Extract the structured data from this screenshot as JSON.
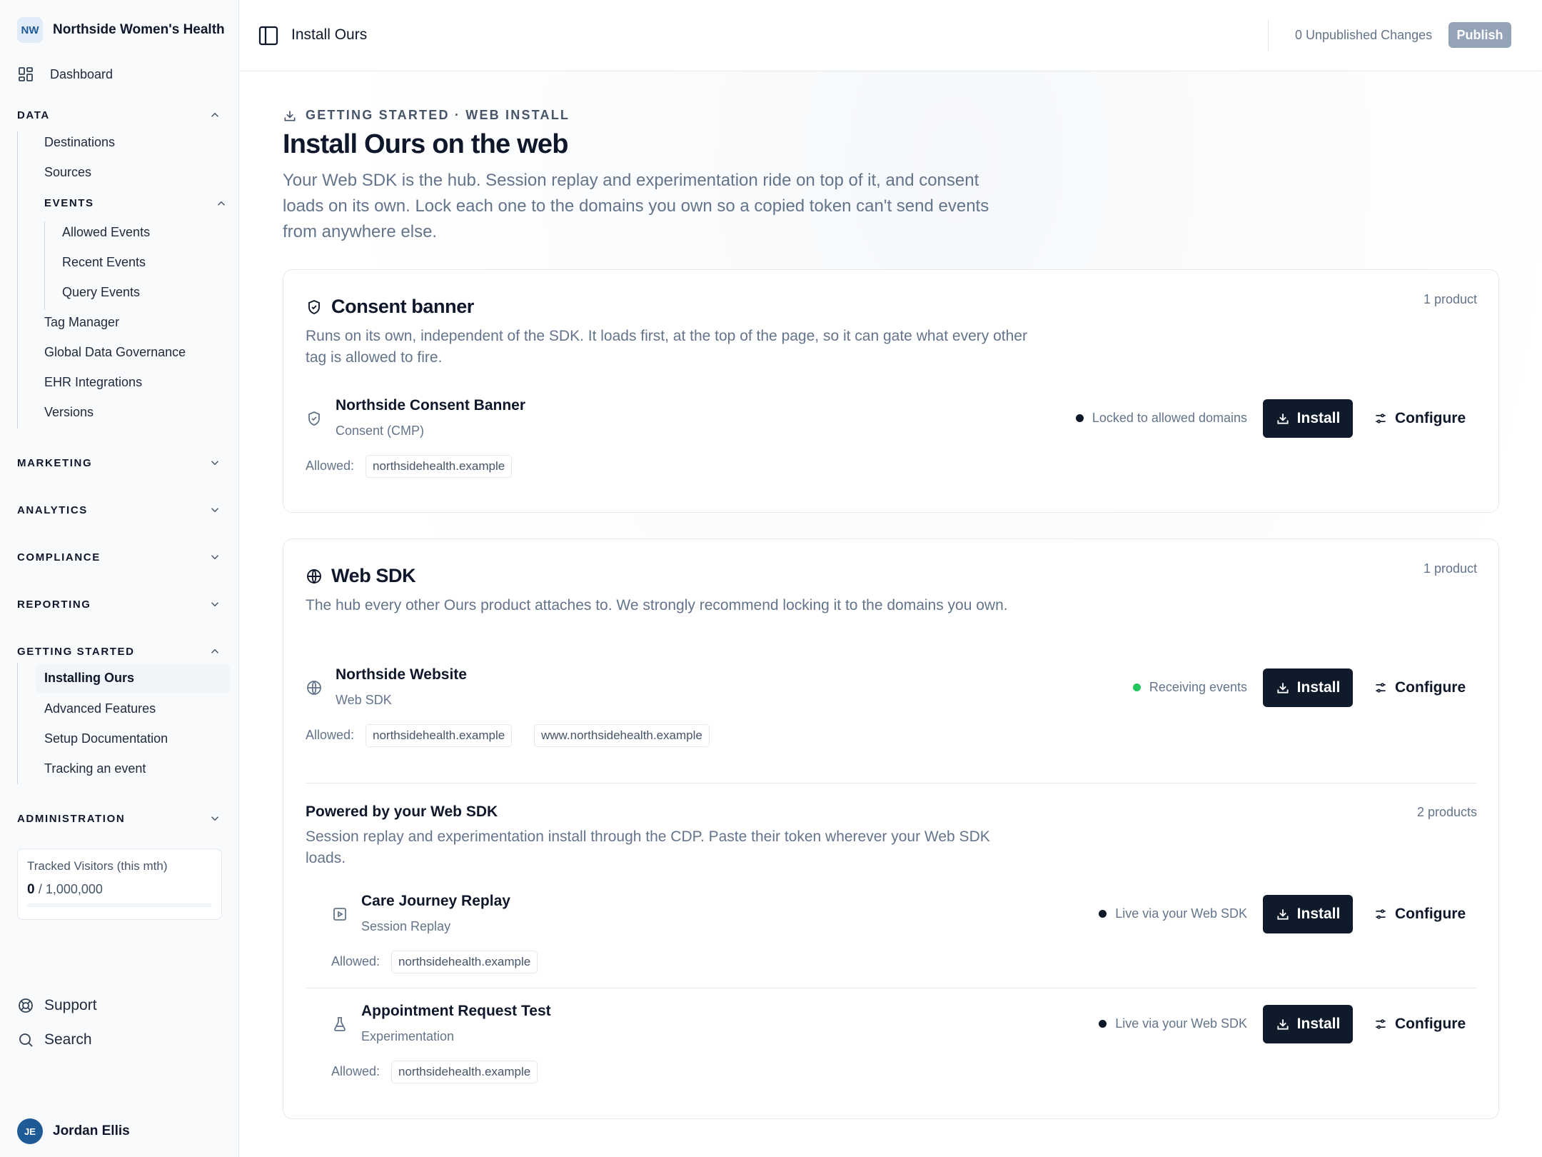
{
  "sidebar": {
    "org_initials": "NW",
    "org_name": "Northside Women's Health",
    "dashboard": "Dashboard",
    "sections": {
      "data": "DATA",
      "marketing": "MARKETING",
      "analytics": "ANALYTICS",
      "compliance": "COMPLIANCE",
      "reporting": "REPORTING",
      "getting_started": "GETTING STARTED",
      "administration": "ADMINISTRATION"
    },
    "data_items": [
      "Destinations",
      "Sources",
      "Tag Manager",
      "Global Data Governance",
      "EHR Integrations",
      "Versions"
    ],
    "events_label": "EVENTS",
    "events_items": [
      "Allowed Events",
      "Recent Events",
      "Query Events"
    ],
    "getting_started_items": [
      "Installing Ours",
      "Advanced Features",
      "Setup Documentation",
      "Tracking an event"
    ],
    "tracked": {
      "label": "Tracked Visitors (this mth)",
      "value": "0",
      "limit": "/ 1,000,000",
      "usage_fraction": 0
    },
    "support": "Support",
    "search": "Search",
    "user": {
      "initials": "JE",
      "name": "Jordan Ellis"
    }
  },
  "header": {
    "title": "Install Ours",
    "unpublished": "0 Unpublished Changes",
    "publish": "Publish"
  },
  "main": {
    "eyebrow": "GETTING STARTED · WEB INSTALL",
    "title": "Install Ours on the web",
    "lede": "Your Web SDK is the hub. Session replay and experimentation ride on top of it, and consent loads on its own. Lock each one to the domains you own so a copied token can't send events from anywhere else.",
    "consent": {
      "title": "Consent banner",
      "count": "1 product",
      "desc": "Runs on its own, independent of the SDK. It loads first, at the top of the page, so it can gate what every other tag is allowed to fire.",
      "product": {
        "name": "Northside Consent Banner",
        "type": "Consent (CMP)",
        "status": "Locked to allowed domains",
        "install": "Install",
        "configure": "Configure",
        "allowed_label": "Allowed:",
        "domains": [
          "northsidehealth.example"
        ]
      }
    },
    "sdk": {
      "title": "Web SDK",
      "count": "1 product",
      "desc": "The hub every other Ours product attaches to. We strongly recommend locking it to the domains you own.",
      "product": {
        "name": "Northside Website",
        "type": "Web SDK",
        "status": "Receiving events",
        "install": "Install",
        "configure": "Configure",
        "allowed_label": "Allowed:",
        "domains": [
          "northsidehealth.example",
          "www.northsidehealth.example"
        ]
      },
      "powered": {
        "title": "Powered by your Web SDK",
        "count": "2 products",
        "desc": "Session replay and experimentation install through the CDP. Paste their token wherever your Web SDK loads.",
        "products": [
          {
            "name": "Care Journey Replay",
            "type": "Session Replay",
            "status": "Live via your Web SDK",
            "install": "Install",
            "configure": "Configure",
            "allowed_label": "Allowed:",
            "domains": [
              "northsidehealth.example"
            ]
          },
          {
            "name": "Appointment Request Test",
            "type": "Experimentation",
            "status": "Live via your Web SDK",
            "install": "Install",
            "configure": "Configure",
            "allowed_label": "Allowed:",
            "domains": [
              "northsidehealth.example"
            ]
          }
        ]
      }
    }
  },
  "colors": {
    "primary_button": "#0f1b2a",
    "status_green": "#22c55e",
    "status_dark": "#0f172a",
    "publish_disabled": "#94a3b8"
  }
}
